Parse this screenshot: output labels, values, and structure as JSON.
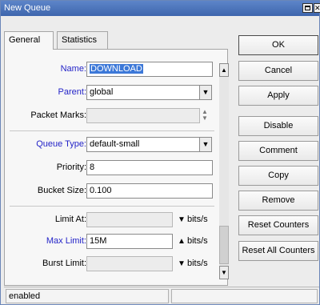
{
  "window": {
    "title": "New Queue"
  },
  "tabs": [
    {
      "label": "General",
      "active": true
    },
    {
      "label": "Statistics",
      "active": false
    }
  ],
  "form": {
    "name_label": "Name:",
    "name_value": "DOWNLOAD",
    "parent_label": "Parent:",
    "parent_value": "global",
    "packet_marks_label": "Packet Marks:",
    "packet_marks_value": "",
    "queue_type_label": "Queue Type:",
    "queue_type_value": "default-small",
    "priority_label": "Priority:",
    "priority_value": "8",
    "bucket_size_label": "Bucket Size:",
    "bucket_size_value": "0.100",
    "limit_at_label": "Limit At:",
    "limit_at_value": "",
    "limit_at_unit": "bits/s",
    "max_limit_label": "Max Limit:",
    "max_limit_value": "15M",
    "max_limit_unit": "bits/s",
    "burst_limit_label": "Burst Limit:",
    "burst_limit_value": "",
    "burst_limit_unit": "bits/s"
  },
  "buttons": {
    "ok": "OK",
    "cancel": "Cancel",
    "apply": "Apply",
    "disable": "Disable",
    "comment": "Comment",
    "copy": "Copy",
    "remove": "Remove",
    "reset_counters": "Reset Counters",
    "reset_all_counters": "Reset All Counters"
  },
  "status": {
    "text": "enabled"
  },
  "colors": {
    "titlebar": "#3e66ad",
    "label_blue": "#2424c8",
    "selection": "#3c78d8"
  },
  "icons": [
    "maximize-icon",
    "close-icon",
    "dropdown-icon",
    "up-down-icon",
    "arrow-down-icon",
    "arrow-up-icon",
    "scroll-up-icon",
    "scroll-down-icon"
  ]
}
